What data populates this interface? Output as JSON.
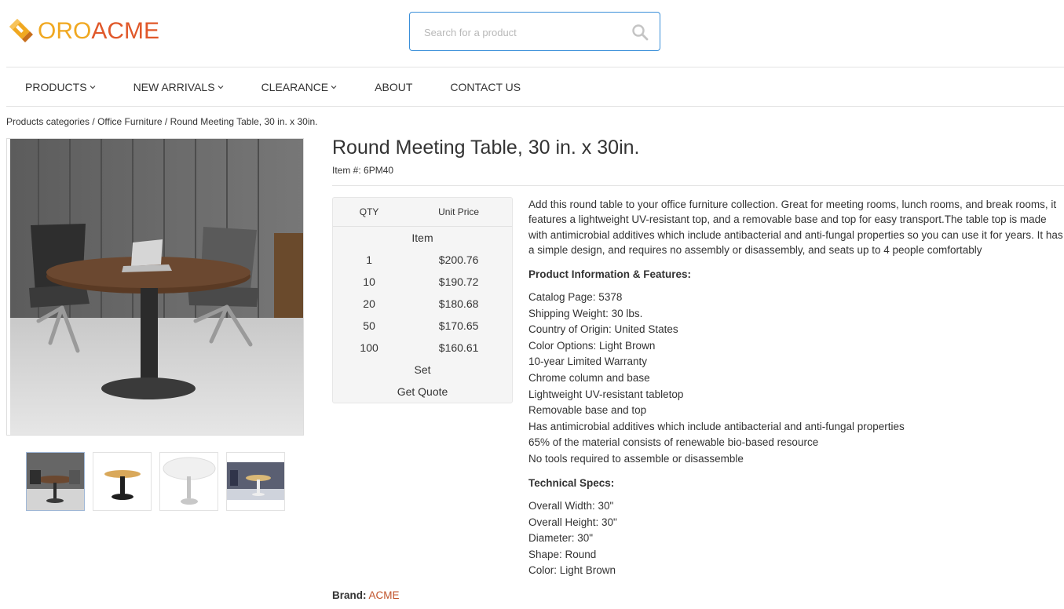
{
  "brand": {
    "part1": "ORO",
    "part2": "ACME",
    "colors": {
      "oro": "#f0a821",
      "acme": "#e0582a"
    }
  },
  "search": {
    "placeholder": "Search for a product",
    "icon": "search-icon"
  },
  "nav": [
    {
      "label": "PRODUCTS",
      "dropdown": true
    },
    {
      "label": "NEW ARRIVALS",
      "dropdown": true
    },
    {
      "label": "CLEARANCE",
      "dropdown": true
    },
    {
      "label": "ABOUT",
      "dropdown": false
    },
    {
      "label": "CONTACT US",
      "dropdown": false
    }
  ],
  "breadcrumb": {
    "items": [
      "Products categories",
      "Office Furniture",
      "Round Meeting Table, 30 in. x 30in."
    ],
    "separator": "/"
  },
  "product": {
    "title": "Round Meeting Table, 30 in. x 30in.",
    "item_number": "Item #: 6PM40",
    "description": "Add this round table to your office furniture collection. Great for meeting rooms, lunch rooms, and break rooms, it features a lightweight UV-resistant top, and a removable base and top for easy transport.The table top is made with antimicrobial additives which include antibacterial and anti-fungal properties so you can use it for years. It has a simple design, and requires no assembly or disassembly, and seats up to 4 people comfortably"
  },
  "pricing": {
    "qty_header": "QTY",
    "price_header": "Unit Price",
    "unit_item": "Item",
    "rows": [
      {
        "qty": "1",
        "price": "$200.76"
      },
      {
        "qty": "10",
        "price": "$190.72"
      },
      {
        "qty": "20",
        "price": "$180.68"
      },
      {
        "qty": "50",
        "price": "$170.65"
      },
      {
        "qty": "100",
        "price": "$160.61"
      }
    ],
    "unit_set": "Set",
    "quote_label": "Get Quote"
  },
  "features": {
    "heading": "Product Information & Features:",
    "items": [
      "Catalog Page: 5378",
      "Shipping Weight: 30 lbs.",
      "Country of Origin: United States",
      "Color Options: Light Brown",
      "10-year Limited Warranty",
      "Chrome column and base",
      "Lightweight UV-resistant tabletop",
      "Removable base and top",
      "Has antimicrobial additives which include antibacterial and anti-fungal properties",
      "65% of the material consists of renewable bio-based resource",
      "No tools required to assemble or disassemble"
    ]
  },
  "specs": {
    "heading": "Technical Specs:",
    "items": [
      "Overall Width: 30\"",
      "Overall Height: 30\"",
      "Diameter: 30\"",
      "Shape: Round",
      "Color: Light Brown"
    ]
  },
  "brand_field": {
    "label": "Brand:",
    "value": "ACME",
    "link_color": "#c0522a"
  },
  "thumbnails": [
    "meeting-room-walnut",
    "oak-top-black-base",
    "white-top-chrome-base",
    "white-base-room-scene"
  ]
}
